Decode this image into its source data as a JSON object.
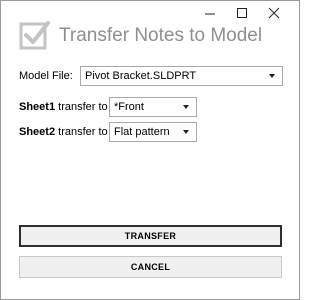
{
  "window": {
    "title": "Transfer Notes to Model",
    "controls": {
      "minimize": "minimize-icon",
      "maximize": "maximize-icon",
      "close": "close-icon"
    },
    "logo_icon": "checkbox-logo-icon"
  },
  "model_file": {
    "label": "Model File:",
    "value": "Pivot Bracket.SLDPRT"
  },
  "sheets": [
    {
      "name": "Sheet1",
      "label": " transfer to",
      "value": "*Front"
    },
    {
      "name": "Sheet2",
      "label": " transfer to",
      "value": "Flat pattern"
    }
  ],
  "buttons": {
    "transfer": "TRANSFER",
    "cancel": "CANCEL"
  }
}
